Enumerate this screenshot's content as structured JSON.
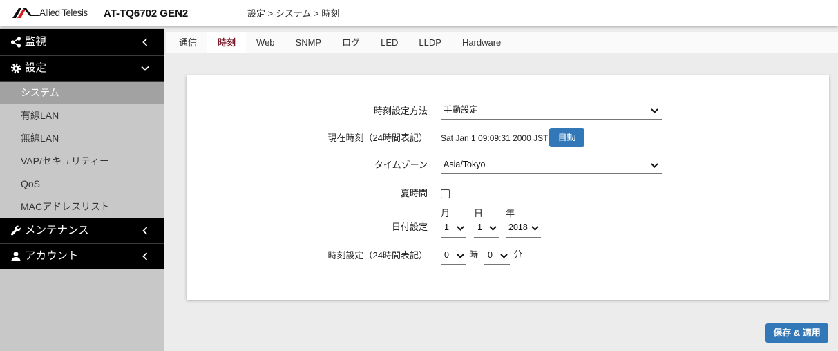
{
  "colors": {
    "accent": "#3278b8",
    "active_tab_text": "#7a1b2c",
    "sidebar_dark": "#000000",
    "sidebar_light": "#c8c8c8",
    "sidebar_active": "#a2a2a2",
    "logo_red": "#d7191f"
  },
  "header": {
    "logo_text": "Allied Telesis",
    "product": "AT-TQ6702 GEN2",
    "breadcrumb": "設定 > システム > 時刻"
  },
  "sidebar": {
    "monitor": {
      "label": "監視",
      "icon": "share-icon",
      "expanded": false
    },
    "settings": {
      "label": "設定",
      "icon": "gear-icon",
      "expanded": true,
      "items": [
        {
          "label": "システム",
          "active": true
        },
        {
          "label": "有線LAN",
          "active": false
        },
        {
          "label": "無線LAN",
          "active": false
        },
        {
          "label": "VAP/セキュリティー",
          "active": false
        },
        {
          "label": "QoS",
          "active": false
        },
        {
          "label": "MACアドレスリスト",
          "active": false
        }
      ]
    },
    "maintenance": {
      "label": "メンテナンス",
      "icon": "wrench-icon",
      "expanded": false
    },
    "account": {
      "label": "アカウント",
      "icon": "user-icon",
      "expanded": false
    }
  },
  "tabs": [
    {
      "label": "通信",
      "active": false
    },
    {
      "label": "時刻",
      "active": true
    },
    {
      "label": "Web",
      "active": false
    },
    {
      "label": "SNMP",
      "active": false
    },
    {
      "label": "ログ",
      "active": false
    },
    {
      "label": "LED",
      "active": false
    },
    {
      "label": "LLDP",
      "active": false
    },
    {
      "label": "Hardware",
      "active": false
    }
  ],
  "form": {
    "method": {
      "label": "時刻設定方法",
      "value": "手動設定"
    },
    "current_time": {
      "label": "現在時刻（24時間表記）",
      "value": "Sat Jan 1 09:09:31 2000 JST",
      "auto_button": "自動"
    },
    "timezone": {
      "label": "タイムゾーン",
      "value": "Asia/Tokyo"
    },
    "dst": {
      "label": "夏時間",
      "checked": false
    },
    "date": {
      "label": "日付設定",
      "month_label": "月",
      "month": "1",
      "day_label": "日",
      "day": "1",
      "year_label": "年",
      "year": "2018"
    },
    "time": {
      "label": "時刻設定（24時間表記）",
      "hour": "0",
      "hour_unit": "時",
      "minute": "0",
      "minute_unit": "分"
    }
  },
  "save_button": "保存 & 適用"
}
